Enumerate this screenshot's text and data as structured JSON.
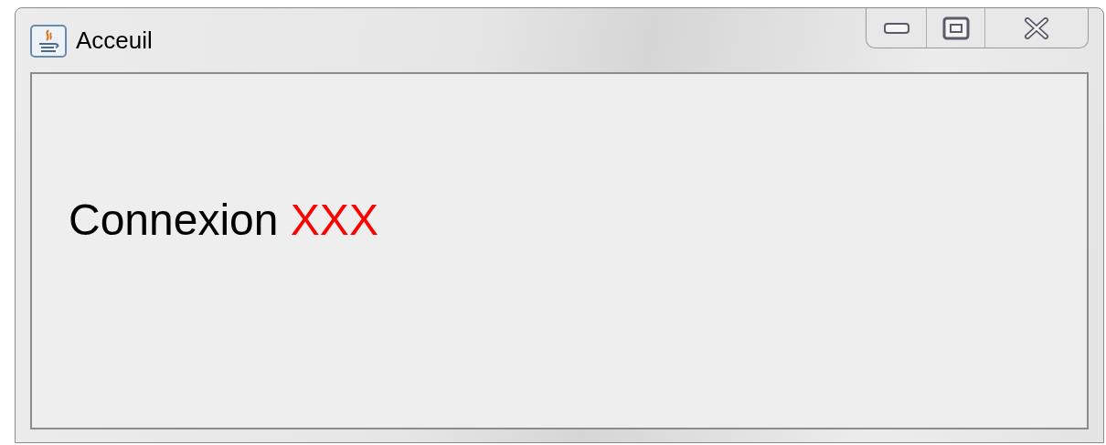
{
  "window": {
    "title": "Acceuil"
  },
  "content": {
    "parts": [
      {
        "text": "Connexion",
        "color": "#000000"
      },
      {
        "text": "XXX",
        "color": "#ff0000"
      }
    ]
  }
}
